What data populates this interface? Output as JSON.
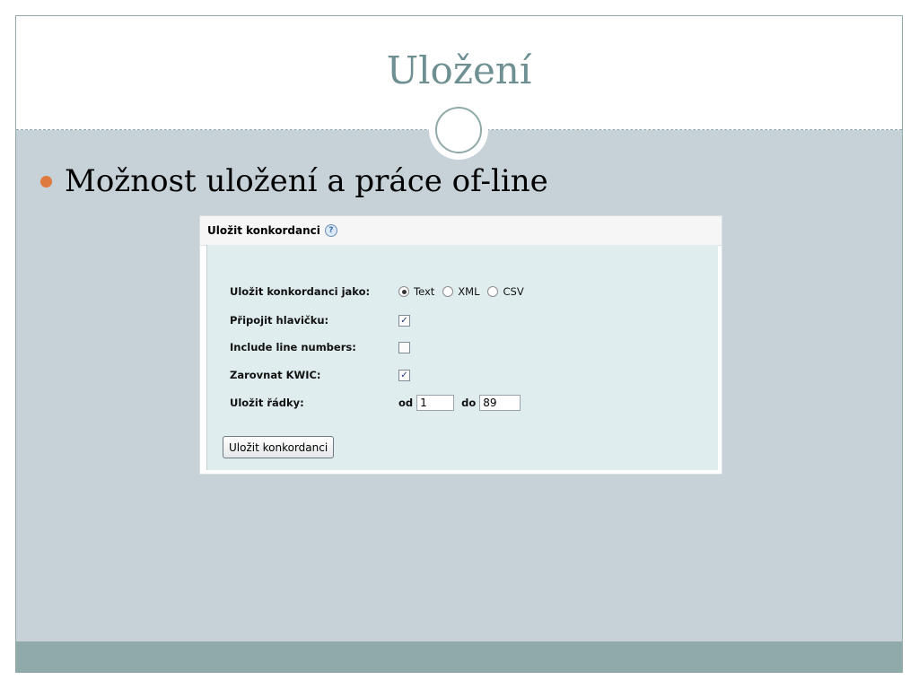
{
  "slide": {
    "title": "Uložení",
    "bullet": "Možnost uložení a práce of-line"
  },
  "panel": {
    "header": "Uložit konkordanci",
    "help_icon": "?",
    "format_label": "Uložit konkordanci jako:",
    "format_options": [
      "Text",
      "XML",
      "CSV"
    ],
    "format_selected": "Text",
    "header_label": "Připojit hlavičku:",
    "header_checked": true,
    "line_numbers_label": "Include line numbers:",
    "line_numbers_checked": false,
    "kwic_label": "Zarovnat KWIC:",
    "kwic_checked": true,
    "rows_label": "Uložit řádky:",
    "from_label": "od",
    "from_value": "1",
    "to_label": "do",
    "to_value": "89",
    "submit_label": "Uložit konkordanci",
    "check_mark": "✓"
  },
  "icons": {
    "help": "help-icon",
    "radio": "radio-icon",
    "checkbox": "checkbox-icon"
  },
  "colors": {
    "title": "#6f9093",
    "accent_bullet": "#e0793f",
    "content_bg": "#c6d1d8",
    "footer": "#8faaa8",
    "panel_body": "#e0edee"
  }
}
